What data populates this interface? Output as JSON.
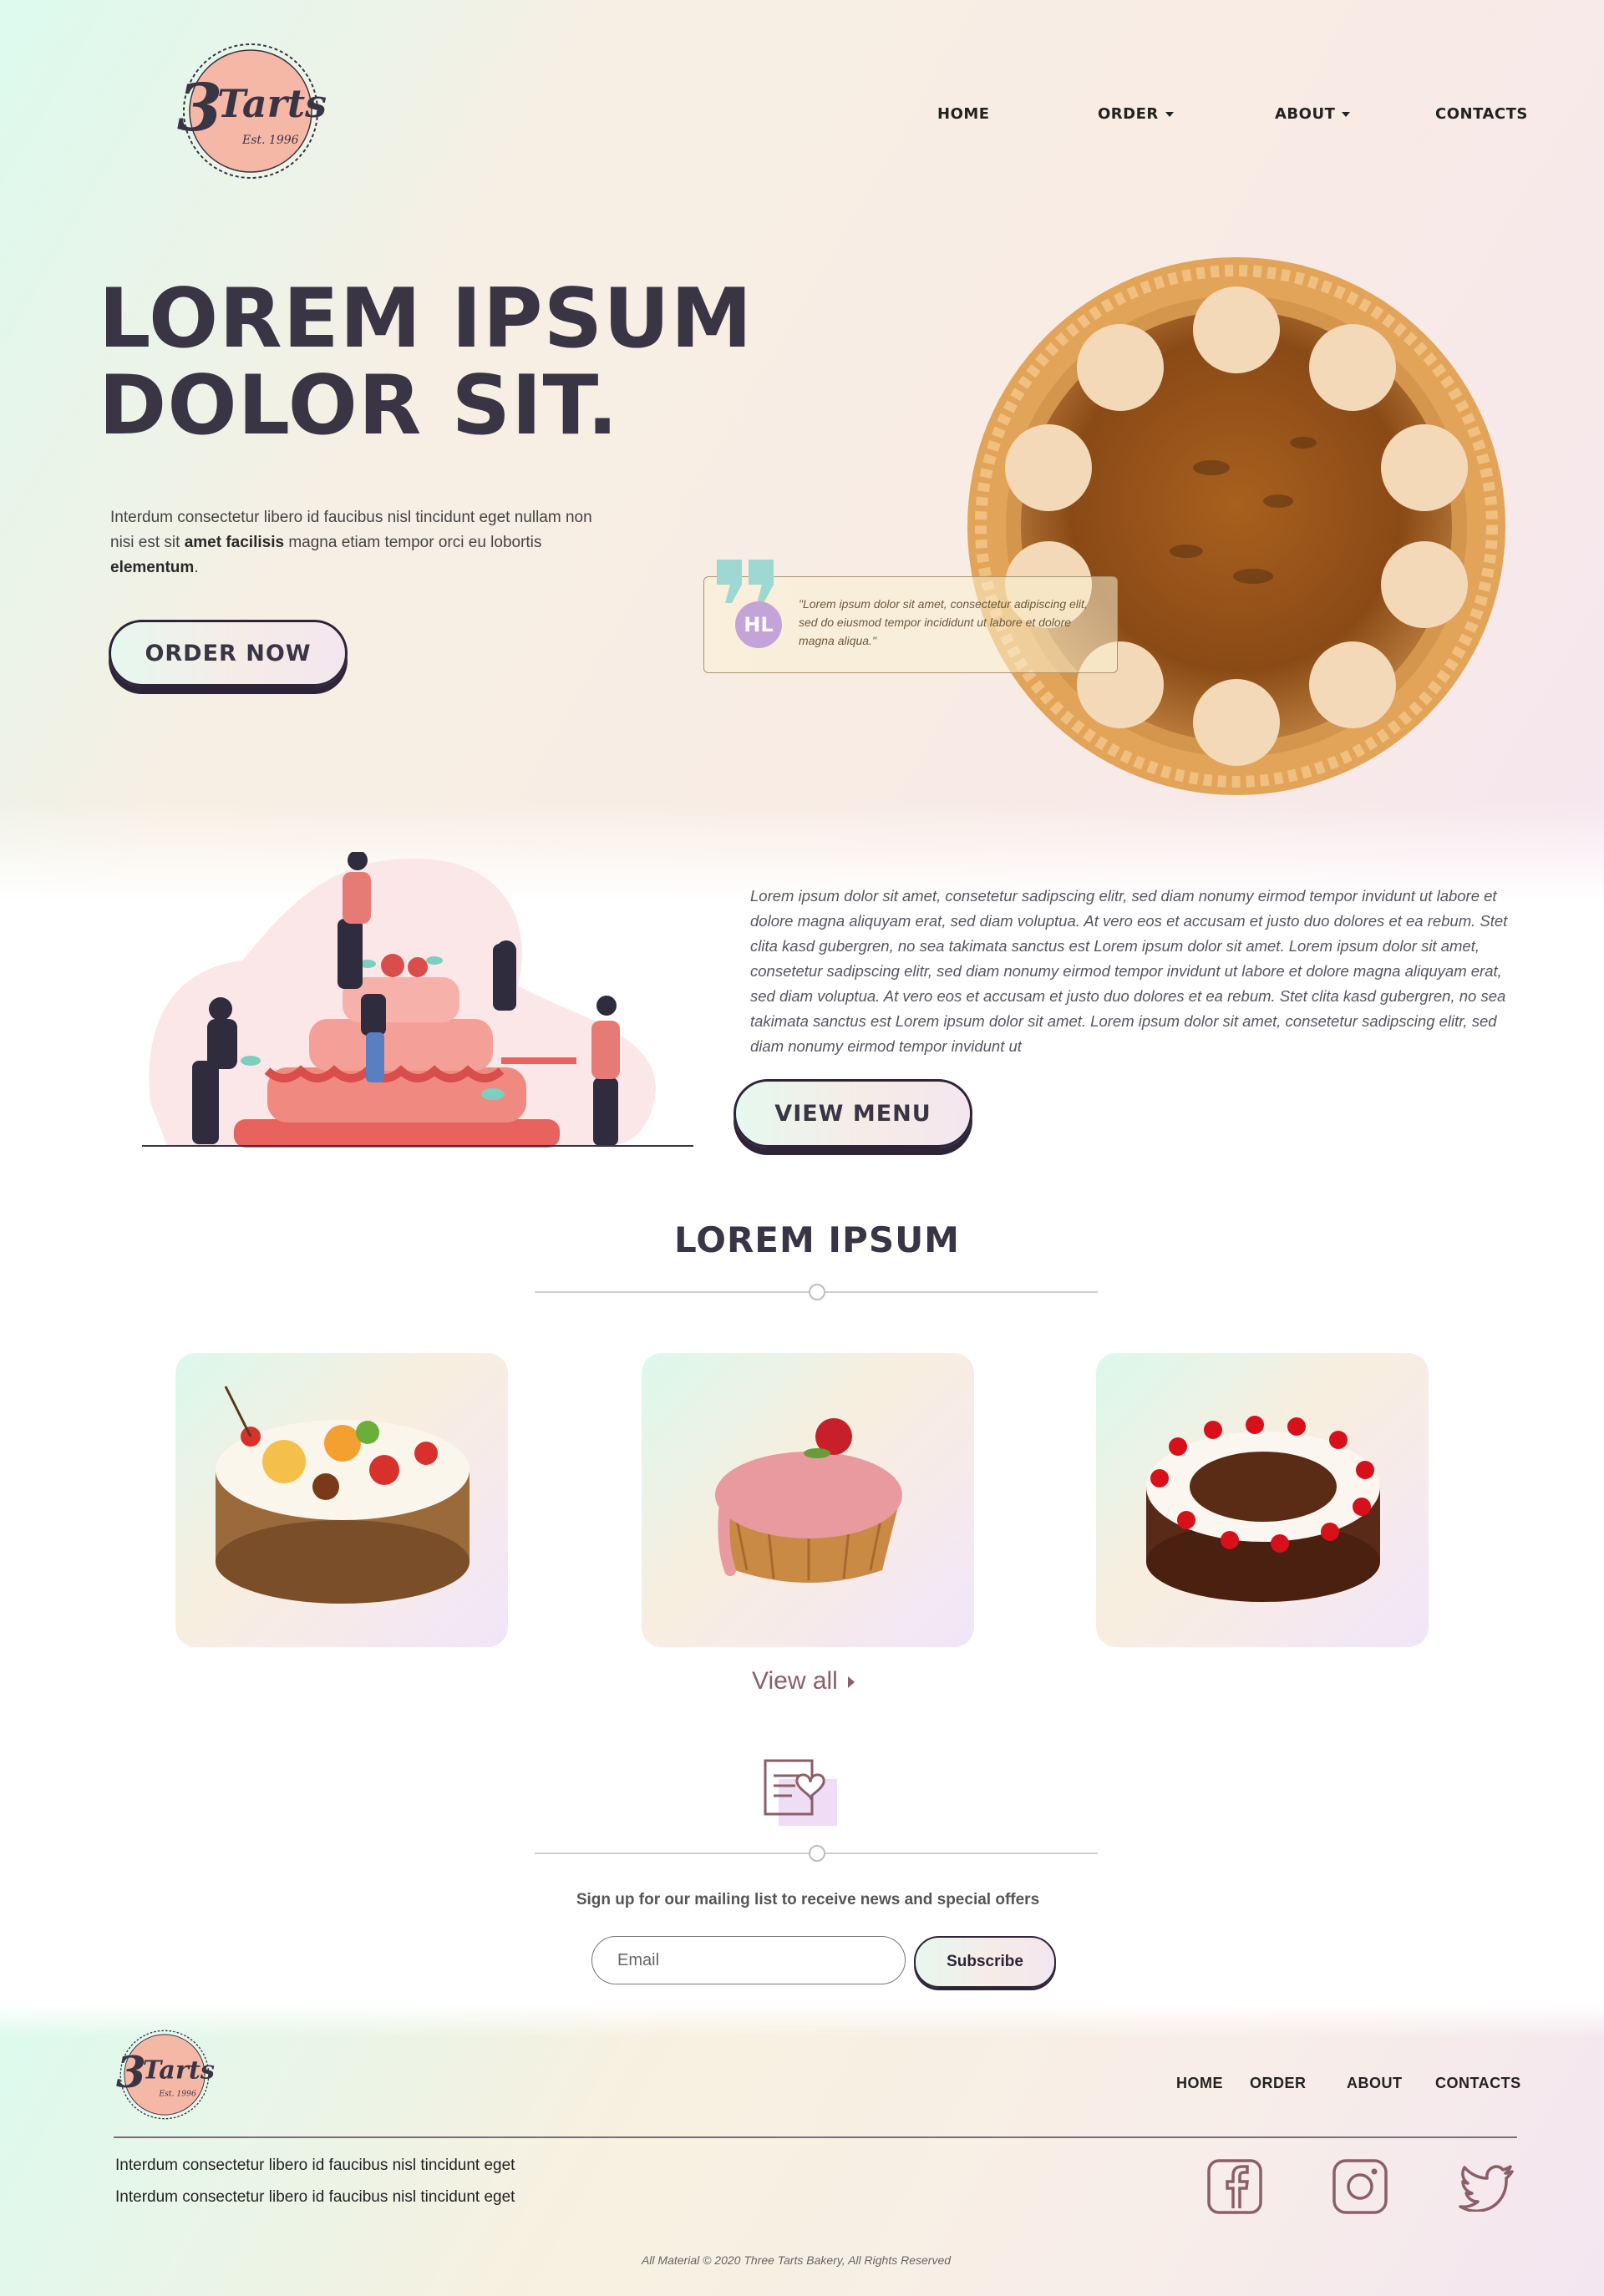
{
  "brand": {
    "logo_number": "3",
    "logo_word": "Tarts",
    "logo_est": "Est. 1996"
  },
  "nav": {
    "home": "HOME",
    "order": "ORDER",
    "about": "ABOUT",
    "contacts": "CONTACTS"
  },
  "hero": {
    "title_line1": "LOREM IPSUM",
    "title_line2": "DOLOR SIT.",
    "desc_part1": "Interdum consectetur libero id faucibus nisl tincidunt eget nullam non nisi est sit ",
    "desc_bold1": "amet facilisis",
    "desc_part2": " magna etiam tempor orci eu lobortis ",
    "desc_bold2": "elementum",
    "desc_part3": ".",
    "order_button": "ORDER NOW"
  },
  "testimonial": {
    "initials": "HL",
    "text": "\"Lorem ipsum dolor sit amet, consectetur adipiscing elit, sed do eiusmod tempor incididunt ut labore et dolore magna aliqua.\""
  },
  "about": {
    "text": "Lorem ipsum dolor sit amet, consetetur sadipscing elitr, sed diam nonumy eirmod tempor invidunt ut labore et dolore magna aliquyam erat, sed diam voluptua. At vero eos et accusam et justo duo dolores et ea rebum. Stet clita kasd gubergren, no sea takimata sanctus est Lorem ipsum dolor sit amet. Lorem ipsum dolor sit amet, consetetur sadipscing elitr, sed diam nonumy eirmod tempor invidunt ut labore et dolore magna aliquyam erat, sed diam voluptua. At vero eos et accusam et justo duo dolores et ea rebum. Stet clita kasd gubergren, no sea takimata sanctus est Lorem ipsum dolor sit amet. Lorem ipsum dolor sit amet, consetetur sadipscing elitr, sed diam nonumy eirmod tempor invidunt ut",
    "menu_button": "VIEW MENU"
  },
  "products": {
    "title": "LOREM IPSUM",
    "view_all": "View all"
  },
  "newsletter": {
    "text": "Sign up for our mailing list to receive news and special offers",
    "email_placeholder": "Email",
    "subscribe": "Subscribe"
  },
  "footer": {
    "home": "HOME",
    "order": "ORDER",
    "about": "ABOUT",
    "contacts": "CONTACTS",
    "line1": "Interdum consectetur libero id faucibus nisl tincidunt eget",
    "line2": "Interdum consectetur libero id faucibus nisl tincidunt eget",
    "copyright": "All Material © 2020 Three Tarts  Bakery, All Rights Reserved"
  },
  "icons": [
    "facebook-icon",
    "instagram-icon",
    "twitter-icon",
    "quote-icon",
    "newsletter-icon"
  ],
  "colors": {
    "dark": "#3a3545",
    "accent": "#8a5f68",
    "logo_peach": "#f6b8a6"
  }
}
